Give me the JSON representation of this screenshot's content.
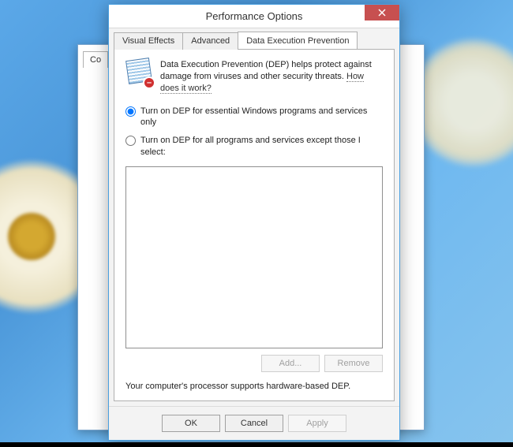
{
  "window": {
    "title": "Performance Options"
  },
  "tabs": {
    "visual_effects": "Visual Effects",
    "advanced": "Advanced",
    "dep": "Data Execution Prevention"
  },
  "behind": {
    "tab_fragment": "Co"
  },
  "dep": {
    "intro": "Data Execution Prevention (DEP) helps protect against damage from viruses and other security threats. ",
    "intro_link": "How does it work?",
    "radio_essential": "Turn on DEP for essential Windows programs and services only",
    "radio_all": "Turn on DEP for all programs and services except those I select:",
    "add_button": "Add...",
    "remove_button": "Remove",
    "status": "Your computer's processor supports hardware-based DEP."
  },
  "buttons": {
    "ok": "OK",
    "cancel": "Cancel",
    "apply": "Apply"
  },
  "icons": {
    "close": "close",
    "dep_badge": "–"
  }
}
